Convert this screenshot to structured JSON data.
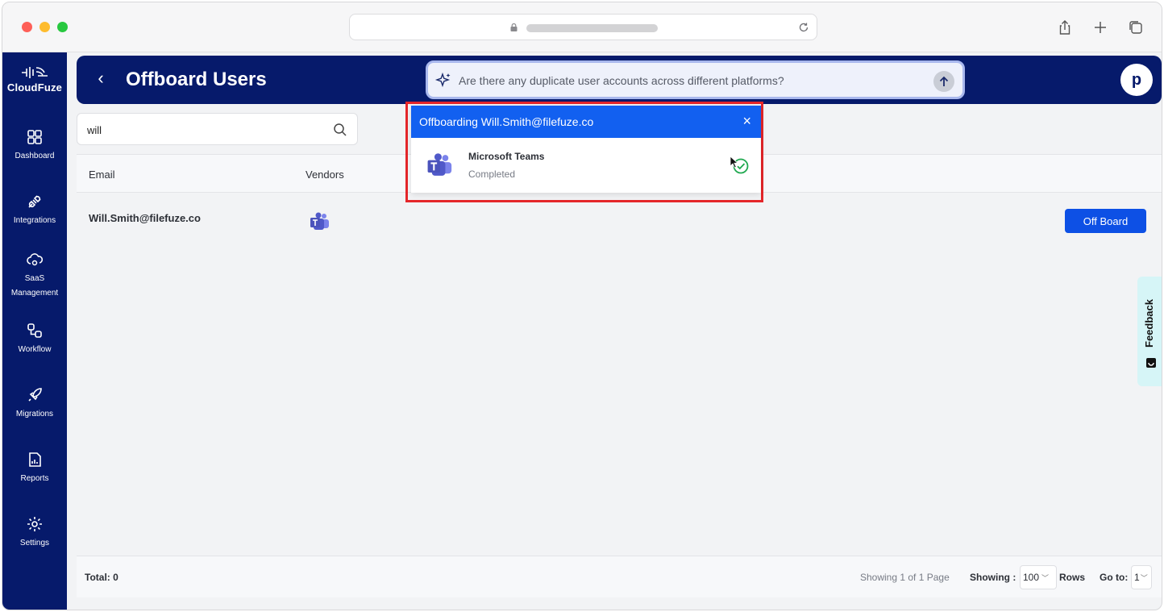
{
  "app": {
    "logo_text": "CloudFuze",
    "colors": {
      "sidebar": "#061a6b",
      "primary_button": "#0d50e5",
      "popup_header": "#1260f0",
      "highlight": "#e5262a",
      "success": "#1fa84f"
    }
  },
  "sidebar": {
    "items": [
      {
        "label": "Dashboard",
        "icon": "dashboard-icon"
      },
      {
        "label": "Integrations",
        "icon": "plug-icon"
      },
      {
        "label": "SaaS Management",
        "icon": "cloud-gear-icon"
      },
      {
        "label": "Workflow",
        "icon": "workflow-icon"
      },
      {
        "label": "Migrations",
        "icon": "rocket-icon"
      },
      {
        "label": "Reports",
        "icon": "report-icon"
      },
      {
        "label": "Settings",
        "icon": "gear-icon"
      }
    ]
  },
  "header": {
    "title": "Offboard Users",
    "ask_placeholder": "Are there any duplicate user accounts across different platforms?",
    "avatar_letter": "p"
  },
  "search": {
    "value": "will"
  },
  "table": {
    "columns": [
      "Email",
      "Vendors"
    ],
    "rows": [
      {
        "email": "Will.Smith@filefuze.co",
        "vendor_icon": "microsoft-teams-icon",
        "action": "Off Board"
      }
    ]
  },
  "footer": {
    "total": "Total: 0",
    "page_info": "Showing 1 of 1 Page",
    "showing_label": "Showing :",
    "rows_value": "100",
    "rows_label": "Rows",
    "goto_label": "Go to:",
    "goto_value": "1"
  },
  "feedback": {
    "label": "Feedback"
  },
  "popup": {
    "title": "Offboarding Will.Smith@filefuze.co",
    "close": "×",
    "vendor_name": "Microsoft Teams",
    "vendor_status": "Completed",
    "status_icon": "check-circle-icon"
  }
}
